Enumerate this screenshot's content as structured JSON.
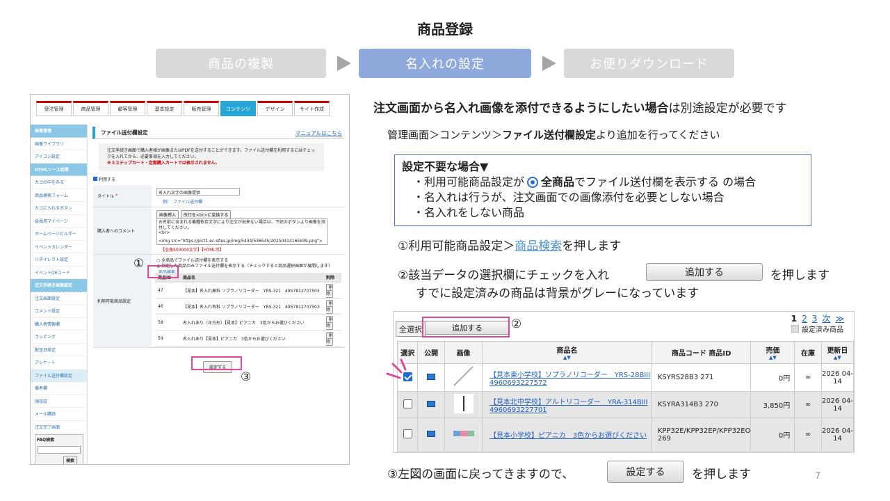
{
  "title": "商品登録",
  "steps": [
    "商品の複製",
    "名入れの設定",
    "お便りダウンロード"
  ],
  "left": {
    "tabs": [
      "受注管理",
      "商品管理",
      "顧客管理",
      "基本設定",
      "販売管理",
      "コンテンツ",
      "デザイン",
      "サイト作成"
    ],
    "sidebar": [
      "画像管理",
      "画像ライブラリ",
      "アイコン設定",
      "HTMLソース取得",
      "カゴの中をみる",
      "商品検索フォーム",
      "カゴに入れるボタン",
      "会員用マイページ",
      "ホームページビルダー",
      "イベントカレンダー",
      "リダイレクト設定",
      "イベントQRコード",
      "注文手続き画面設定",
      "注文画面設定",
      "コメント設定",
      "購入者情報欄",
      "ラッピング",
      "配送日設定",
      "アンケート",
      "ファイル送付欄設定",
      "備考欄",
      "領収証",
      "メール購読",
      "注文完了画面"
    ],
    "faq_label": "FAQ検索",
    "faq_button": "検索",
    "section_title": "ファイル送付欄設定",
    "manual_link": "マニュアルはこちら",
    "note_text": "注文手続き画面で購入者様が画像またはPDFを送付することができます。ファイル送付欄を利用するにはチェックを入れてから、必要事項を入力してください。",
    "note_red": "※３ステップカート・定期購入カートでは表示されません。",
    "use_label": "利用する",
    "title_label": "タイトル",
    "required": "*",
    "title_value": "名入れ文字の画像提供",
    "title_example": "例）　ファイル送付欄",
    "comment_label": "購入者へのコメント",
    "comment_btn1": "画像挿入",
    "comment_btn2": "改行を<br>に変換する",
    "comment_text": "お名前に含まれる機種依存文字により注文が出来ない場合は、下記のボタンより画像を添付してください。",
    "comment_text2": "<br>",
    "comment_text3": "<img src=\"https://pict1.ec-sites.jp/img/5434/536545/20250414165939.png\">",
    "comment_limit": "【全角500000文字】【HTML可】",
    "products_label": "利用可能商品設定",
    "radio1": "全商品でファイル送付欄を表示する",
    "radio2": "指定した商品のみファイル送付欄を表示する（チェックすると商品選択画面が展開します）",
    "search_link": "商品検索",
    "ptable_headers": [
      "商品ID",
      "商品名",
      "削除"
    ],
    "ptable_rows": [
      [
        "47",
        "【見本】名入れ無料 ソプラノリコーダー　YRS-321　4957812707503",
        "削除"
      ],
      [
        "46",
        "【見本】名入れ有料 ソプラノリコーダー　YRS-321　4957812707503",
        "削除"
      ],
      [
        "58",
        "名入れあり（正方形）【見本】ピアニカ　3色からお選びください",
        "削除"
      ],
      [
        "59",
        "名入れあり【見本】ピアニカ　3色からお選びください",
        "削除"
      ]
    ],
    "set_button": "設定する"
  },
  "markers": {
    "one": "①",
    "two": "②",
    "three": "③"
  },
  "right": {
    "heading_bold": "注文画面から名入れ画像を添付できるようにしたい場合",
    "heading_rest": "は別途設定が必要です",
    "path_plain": "管理画面＞コンテンツ＞",
    "path_bold": "ファイル送付欄設定",
    "path_tail": "より追加を行ってください",
    "box_title": "設定不要な場合▼",
    "box_line1_a": "・利用可能商品設定が",
    "box_line1_b": "全商品",
    "box_line1_c": "でファイル送付欄を表示する",
    "box_line1_d": "の場合",
    "box_line2": "・名入れは行うが、注文画面での画像添付を必要としない場合",
    "box_line3": "・名入れをしない商品",
    "step1_a": "①利用可能商品設定＞",
    "step1_link": "商品検索",
    "step1_b": "を押します",
    "step2_a": "②該当データの選択欄にチェックを入れ",
    "step2_btn": "追加する",
    "step2_b": "を押します",
    "step2_c": "すでに設定済みの商品は背景がグレーになっています",
    "step3_a": "③左図の画面に戻ってきますので、",
    "step3_btn": "設定する",
    "step3_b": "を押します"
  },
  "grid": {
    "select_all": "全選択",
    "add_button": "追加する",
    "pager": [
      "1",
      "2",
      "3",
      "次",
      "≫"
    ],
    "legend": "設定済み商品",
    "headers": [
      "選択",
      "公開",
      "画像",
      "商品名",
      "商品コード 商品ID",
      "売価",
      "在庫",
      "更新日"
    ],
    "rows": [
      {
        "name": "【見本東小学校】ソプラノリコーダー　YRS-28BIII 4960693227572",
        "code": "KSYRS28B3 271",
        "price": "0円",
        "stock": "∞",
        "date": "2026 04-14",
        "checked": true,
        "gray": false
      },
      {
        "name": "【見本北中学校】アルトリコーダー　YRA-314BIII 4960693227701",
        "code": "KSYRA314B3 270",
        "price": "3,850円",
        "stock": "∞",
        "date": "2026 04-14",
        "checked": false,
        "gray": true
      },
      {
        "name": "【見本小学校】ピアニカ　3色からお選びください",
        "code": "KPP32E/KPP32EP/KPP32EO 269",
        "price": "0円",
        "stock": "∞",
        "date": "2026 04-14",
        "checked": false,
        "gray": true
      }
    ]
  },
  "page_number": "7"
}
